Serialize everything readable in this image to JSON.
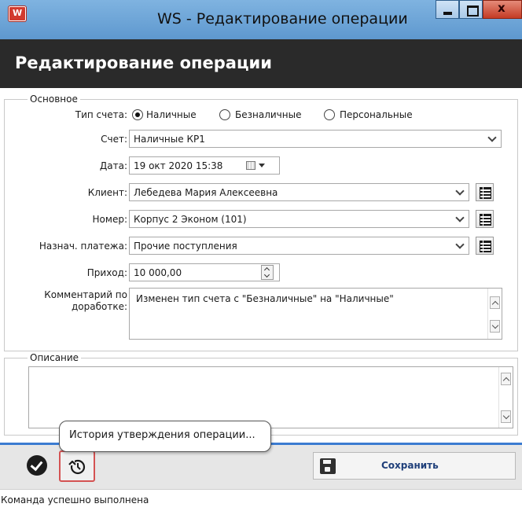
{
  "window": {
    "title": "WS - Редактирование операции"
  },
  "header": {
    "title": "Редактирование операции"
  },
  "main_group": {
    "legend": "Основное",
    "account_type": {
      "label": "Тип счета:",
      "options": [
        "Наличные",
        "Безналичные",
        "Персональные"
      ],
      "selected": "Наличные"
    },
    "account": {
      "label": "Счет:",
      "value": "Наличные КР1"
    },
    "date": {
      "label": "Дата:",
      "value": "19 окт 2020  15:38"
    },
    "client": {
      "label": "Клиент:",
      "value": "Лебедева Мария Алексеевна"
    },
    "room": {
      "label": "Номер:",
      "value": "Корпус 2 Эконом (101)"
    },
    "purpose": {
      "label": "Назнач. платежа:",
      "value": "Прочие поступления"
    },
    "income": {
      "label": "Приход:",
      "value": "10 000,00"
    },
    "comment": {
      "label_line1": "Комментарий по",
      "label_line2": "доработке:",
      "value": "Изменен тип счета с \"Безналичные\" на \"Наличные\""
    }
  },
  "description_group": {
    "legend": "Описание",
    "value": ""
  },
  "toolbar": {
    "tooltip": "История утверждения операции...",
    "save_label": "Сохранить"
  },
  "status": {
    "text": "Команда успешно выполнена"
  },
  "colors": {
    "titlebar": "#6fa5d8",
    "header": "#2a2a2a",
    "toolbar_accent": "#3b7bd1",
    "history_highlight": "#d45252",
    "save_label": "#1f3f7a"
  }
}
